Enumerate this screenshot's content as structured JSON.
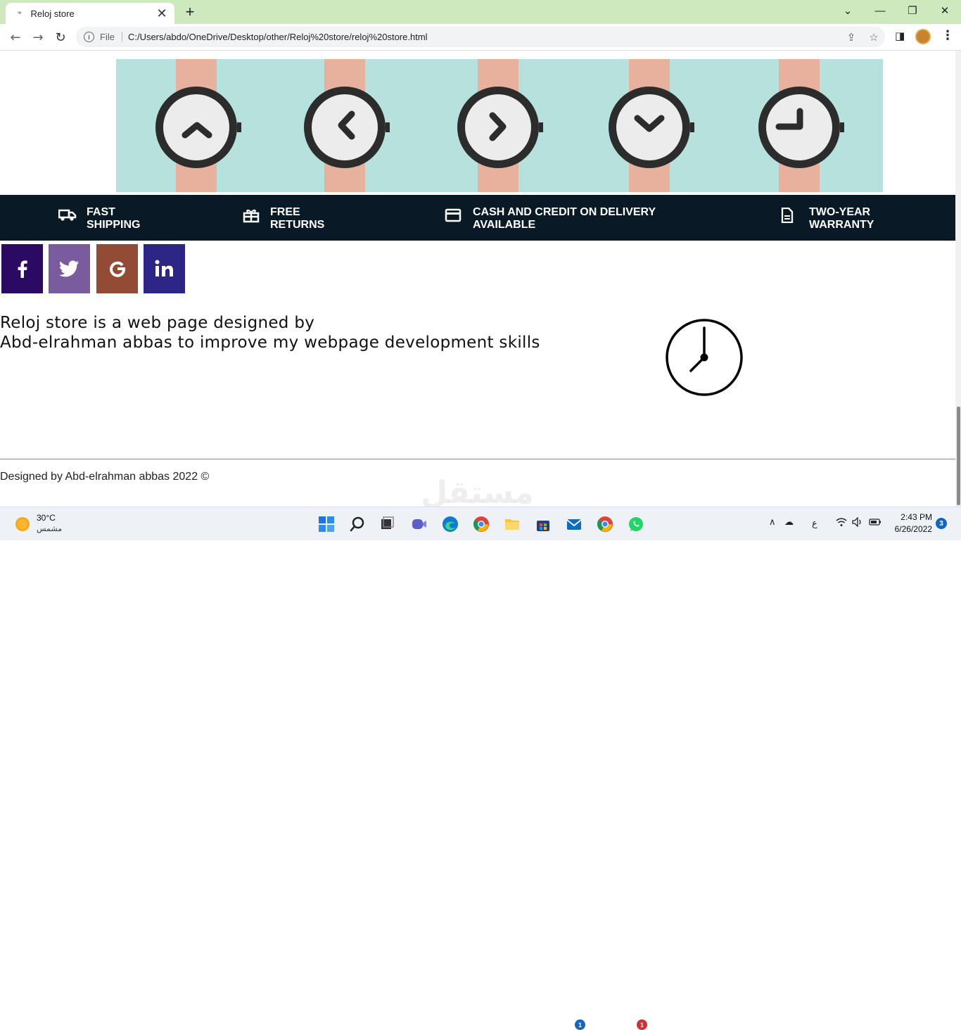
{
  "browser": {
    "tab_title": "Reloj store",
    "url_scheme": "File",
    "url": "C:/Users/abdo/OneDrive/Desktop/other/Reloj%20store/reloj%20store.html"
  },
  "features": [
    {
      "line1": "FAST",
      "line2": "SHIPPING",
      "icon": "truck-icon"
    },
    {
      "line1": "FREE",
      "line2": "RETURNS",
      "icon": "gift-icon"
    },
    {
      "line1": "CASH AND CREDIT ON DELIVERY",
      "line2": "AVAILABLE",
      "icon": "credit-card-icon"
    },
    {
      "line1": "TWO-YEAR",
      "line2": "WARRANTY",
      "icon": "document-icon"
    }
  ],
  "social": [
    {
      "name": "facebook",
      "glyph": "f",
      "color": "#2b0a63"
    },
    {
      "name": "twitter",
      "glyph": "",
      "color": "#7a5b9e"
    },
    {
      "name": "google",
      "glyph": "G",
      "color": "#944b35"
    },
    {
      "name": "linkedin",
      "glyph": "in",
      "color": "#2e2686"
    }
  ],
  "about": {
    "line1": "Reloj store is a web page designed by",
    "line2": "Abd-elrahman abbas to improve my webpage development skills"
  },
  "footer": {
    "text": "Designed by Abd-elrahman abbas 2022 ©"
  },
  "watermark": "مستقل",
  "taskbar": {
    "temperature": "30°C",
    "weather": "مشمس",
    "time": "2:43 PM",
    "date": "6/26/2022",
    "notification_count": "3",
    "mail_badge": "1",
    "whatsapp_badge": "1",
    "language": "ع"
  },
  "colors": {
    "banner_bg": "#b6e1dc",
    "features_bg": "#091a26",
    "strap": "#e7b19d"
  }
}
